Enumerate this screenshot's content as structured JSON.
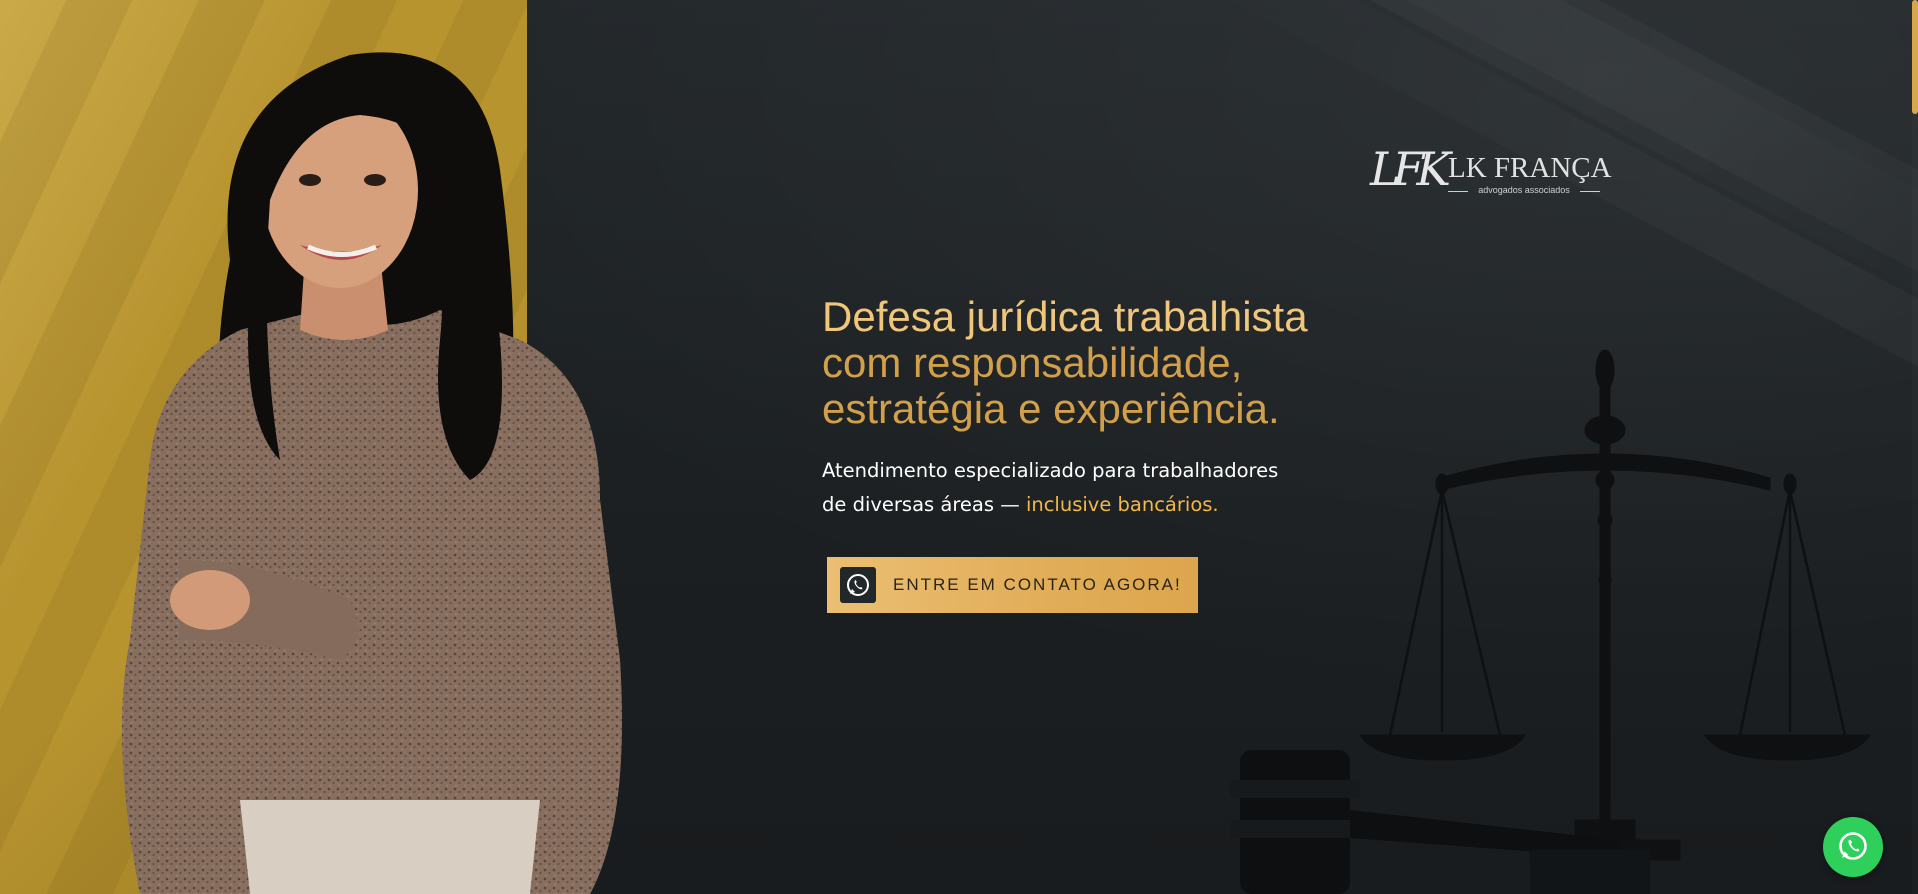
{
  "brand": {
    "monogram": "LFK",
    "name": "LK FRANÇA",
    "tagline": "advogados associados"
  },
  "hero": {
    "headline_line1": "Defesa jurídica trabalhista",
    "headline_line2": "com responsabilidade,",
    "headline_line3": "estratégia e experiência.",
    "subtext_line1": "Atendimento especializado para trabalhadores",
    "subtext_line2_prefix": "de diversas áreas — ",
    "subtext_line2_highlight": "inclusive bancários.",
    "cta_label": "ENTRE EM CONTATO AGORA!"
  },
  "icons": {
    "cta": "whatsapp-icon",
    "floating": "whatsapp-icon"
  },
  "colors": {
    "background": "#1c2022",
    "accent_gold": "#e1ad58",
    "headline_light": "#f0c67a",
    "headline_dark": "#d29f4b",
    "highlight": "#f2b84a",
    "panel_yellow": "#b8942f",
    "whatsapp_green": "#2fcf5c"
  }
}
